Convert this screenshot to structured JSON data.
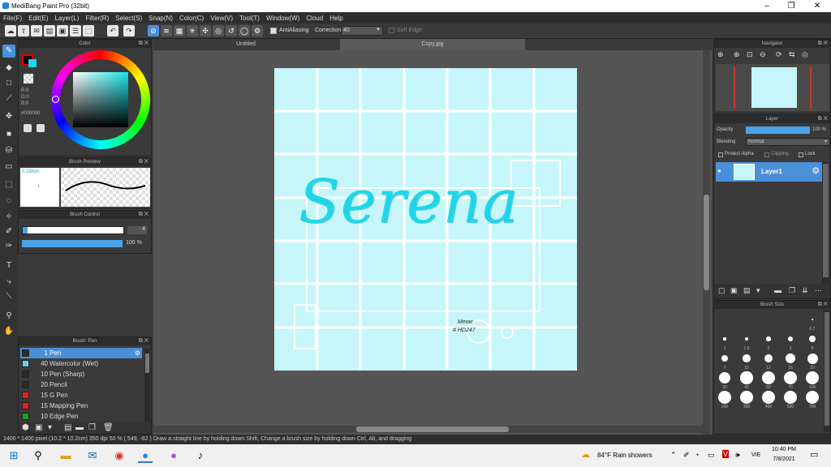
{
  "window": {
    "title": "MediBang Paint Pro (32bit)"
  },
  "menu": [
    "File(F)",
    "Edit(E)",
    "Layer(L)",
    "Filter(R)",
    "Select(S)",
    "Snap(N)",
    "Color(C)",
    "View(V)",
    "Tool(T)",
    "Window(W)",
    "Cloud",
    "Help"
  ],
  "toolbar": {
    "antialias": "AntiAliasing",
    "correction_label": "Correction",
    "correction_value": "40",
    "soft_edge": "Soft Edge"
  },
  "color_panel": {
    "title": "Color",
    "r": "R:0",
    "g": "G:0",
    "b": "B:0",
    "hex": "#000000"
  },
  "brush_preview": {
    "title": "Brush Preview",
    "size": "0.29mm"
  },
  "brush_control": {
    "title": "Brush Control",
    "size_value": "4",
    "opacity_value": "100 %"
  },
  "brush_panel": {
    "title": "Brush: Pen",
    "items": [
      {
        "num": "1",
        "label": "Pen",
        "color": "#2a2a2a"
      },
      {
        "num": "40",
        "label": "Watercolor (Wet)",
        "color": "#58d6e0"
      },
      {
        "num": "10",
        "label": "Pen (Sharp)",
        "color": "#2a2a2a"
      },
      {
        "num": "20",
        "label": "Pencil",
        "color": "#2a2a2a"
      },
      {
        "num": "15",
        "label": "G Pen",
        "color": "#e02020"
      },
      {
        "num": "15",
        "label": "Mapping Pen",
        "color": "#e02020"
      },
      {
        "num": "10",
        "label": "Edge Pen",
        "color": "#20a020"
      }
    ]
  },
  "doc_tabs": [
    "Untitled",
    "Copy.jpg"
  ],
  "canvas": {
    "text": "Serena",
    "note1": "Meow",
    "note2": "# HD247"
  },
  "navigator": {
    "title": "Navigator"
  },
  "layer_panel": {
    "title": "Layer",
    "opacity_label": "Opacity",
    "opacity_value": "100 %",
    "blending_label": "Blending",
    "blending_value": "Normal",
    "protect_alpha": "Protect Alpha",
    "clipping": "Clipping",
    "lock": "Lock",
    "layer_name": "Layer1"
  },
  "brush_size": {
    "title": "Brush Size",
    "sizes": [
      "0.7",
      "1",
      "1.5",
      "2",
      "3",
      "5",
      "7",
      "10",
      "12",
      "15",
      "20",
      "30",
      "40",
      "50",
      "70",
      "100",
      "200",
      "300",
      "400",
      "500",
      "700"
    ]
  },
  "status": "1400 * 1400 pixel  (10.2 * 10.2cm)  350 dpi  50 %  ( 549, -82 )  Draw a straight line by holding down Shift, Change a brush size by holding down Ctrl, Alt, and dragging",
  "taskbar": {
    "weather": "84°F  Rain showers",
    "lang": "VIE",
    "time": "10:40 PM",
    "date": "7/8/2021"
  },
  "colors": {
    "accent": "#4a90d9",
    "canvas_bg": "#c6f6f9",
    "lettering": "#1fd6e8"
  }
}
